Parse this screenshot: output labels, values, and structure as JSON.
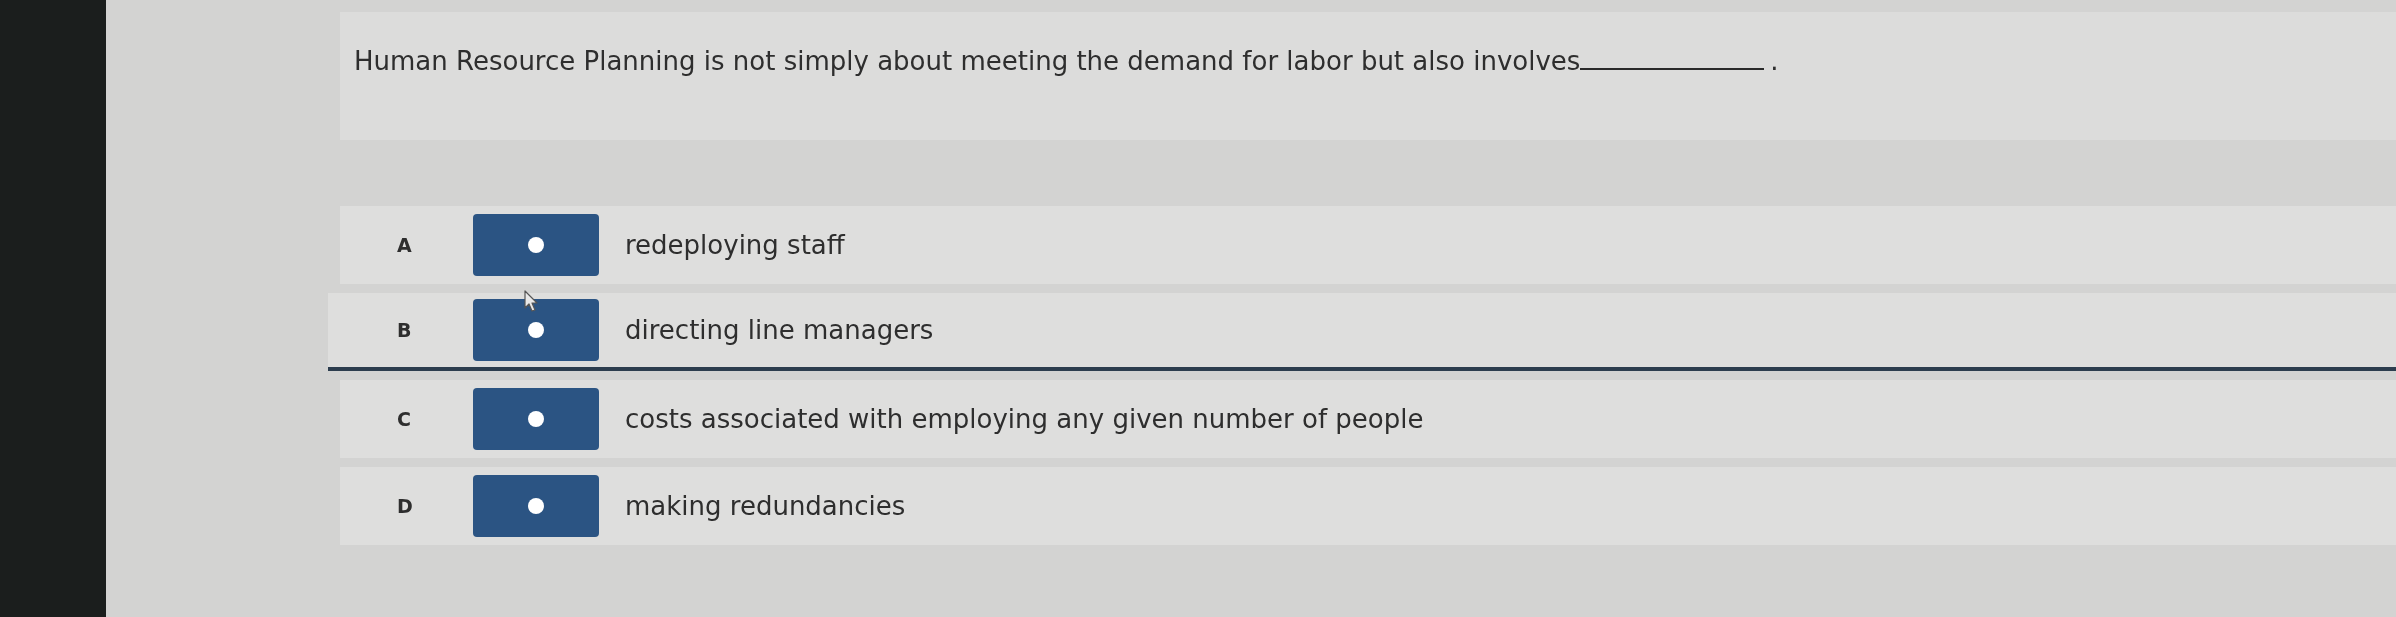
{
  "question": {
    "text": "Human Resource Planning is not simply about meeting the demand for labor but also involves",
    "end_mark": "."
  },
  "options": [
    {
      "letter": "A",
      "text": "redeploying staff",
      "selected": false,
      "focused": false
    },
    {
      "letter": "B",
      "text": "directing line managers",
      "selected": false,
      "focused": true
    },
    {
      "letter": "C",
      "text": "costs associated with employing any given number of people",
      "selected": false,
      "focused": false
    },
    {
      "letter": "D",
      "text": "making redundancies",
      "selected": false,
      "focused": false
    }
  ]
}
